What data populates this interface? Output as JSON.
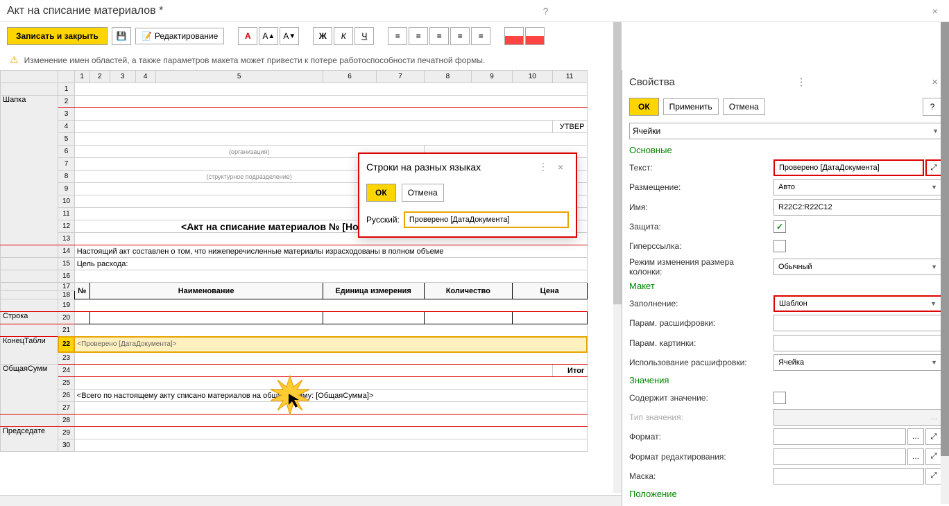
{
  "title": "Акт на списание материалов *",
  "toolbar": {
    "save_close": "Записать и закрыть",
    "edit": "Редактирование"
  },
  "warning": "Изменение имен областей, а также параметров макета может привести к потере работоспособности печатной формы.",
  "columns": [
    "1",
    "2",
    "3",
    "4",
    "5",
    "6",
    "7",
    "8",
    "9",
    "10",
    "11"
  ],
  "areas": {
    "shapka": "Шапка",
    "stroka": "Строка",
    "konets": "КонецТабли",
    "obschaya": "ОбщаяСумм",
    "predsed": "Председате"
  },
  "rows": [
    "1",
    "2",
    "3",
    "4",
    "5",
    "6",
    "7",
    "8",
    "9",
    "10",
    "11",
    "12",
    "13",
    "14",
    "15",
    "16",
    "17",
    "18",
    "19",
    "20",
    "21",
    "22",
    "23",
    "24",
    "25",
    "26",
    "27",
    "28",
    "29",
    "30"
  ],
  "cells": {
    "r5_org": "(организация)",
    "r7_dept": "(структурное подразделение)",
    "r4_approve": "УТВЕР",
    "r12_title": "<Акт на списание материалов № [НомерДокумента] от [ДатаД",
    "r14_text": "Настоящий акт составлен о том, что нижеперечисленные материалы израсходованы в полном объеме",
    "r15_text": "Цель расхода:",
    "r17_h1": "№",
    "r17_h2": "Наименование",
    "r17_h3": "Единица измерения",
    "r17_h4": "Количество",
    "r17_h5": "Цена",
    "r22_text": "<Проверено [ДатаДокумента]>",
    "r24_itogo": "Итог",
    "r26_text": "<Всего по настоящему акту списано материалов на общую сумму: [ОбщаяСумма]>"
  },
  "lang_dialog": {
    "title": "Строки на разных языках",
    "ok": "ОК",
    "cancel": "Отмена",
    "lang_label": "Русский:",
    "value": "Проверено [ДатаДокумента]"
  },
  "props": {
    "title": "Свойства",
    "ok": "ОК",
    "apply": "Применить",
    "cancel": "Отмена",
    "help": "?",
    "selector": "Ячейки",
    "sec_osnov": "Основные",
    "text_label": "Текст:",
    "text_value": "Проверено [ДатаДокумента]",
    "place_label": "Размещение:",
    "place_value": "Авто",
    "name_label": "Имя:",
    "name_value": "R22C2:R22C12",
    "protect_label": "Защита:",
    "hyper_label": "Гиперссылка:",
    "resize_label": "Режим изменения размера колонки:",
    "resize_value": "Обычный",
    "sec_maket": "Макет",
    "fill_label": "Заполнение:",
    "fill_value": "Шаблон",
    "decrypt_label": "Парам. расшифровки:",
    "pic_label": "Парам. картинки:",
    "decrypt_use_label": "Использование расшифровки:",
    "decrypt_use_value": "Ячейка",
    "sec_values": "Значения",
    "contains_label": "Содержит значение:",
    "type_label": "Тип значения:",
    "format_label": "Формат:",
    "format_edit_label": "Формат редактирования:",
    "mask_label": "Маска:",
    "sec_position": "Положение"
  }
}
